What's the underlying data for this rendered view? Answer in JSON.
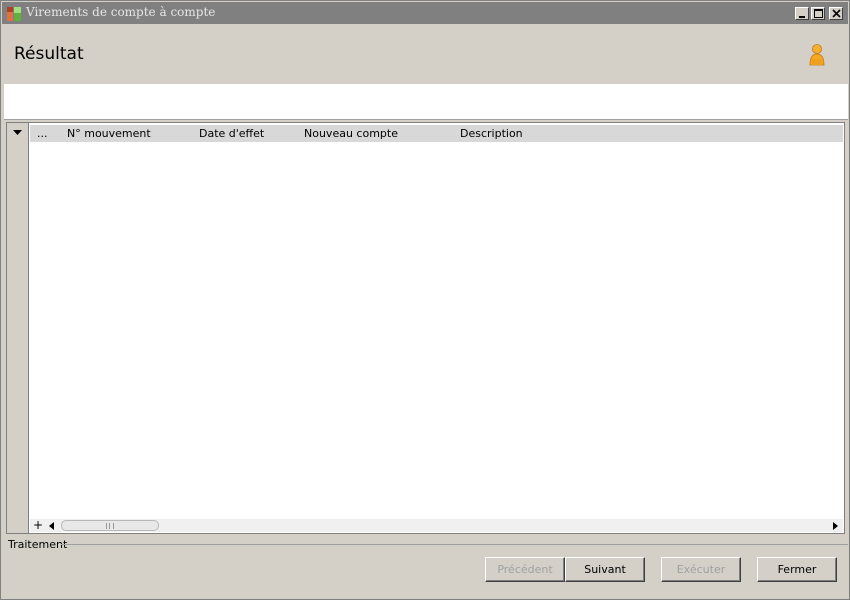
{
  "window": {
    "title": "Virements de compte à compte"
  },
  "header": {
    "title": "Résultat",
    "user_icon": "user-icon"
  },
  "grid": {
    "columns": [
      "...",
      "N° mouvement",
      "Date d'effet",
      "Nouveau compte",
      "Description"
    ],
    "rows": [],
    "add_symbol": "+"
  },
  "footer": {
    "group_label": "Traitement",
    "buttons": {
      "previous": "Précédent",
      "next": "Suivant",
      "execute": "Exécuter",
      "close": "Fermer"
    }
  },
  "colors": {
    "titlebar": "#808080",
    "chrome": "#d4d0c8",
    "user_icon": "#f0a020"
  }
}
